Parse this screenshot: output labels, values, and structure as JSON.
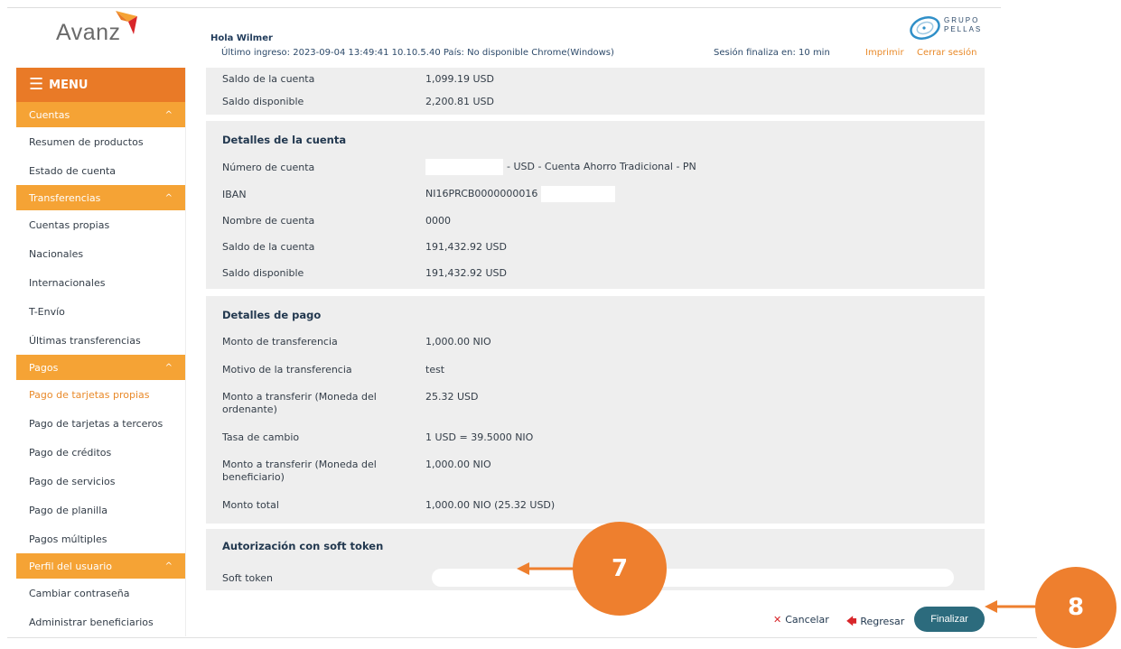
{
  "header": {
    "brand": "Avanz",
    "greeting": "Hola Wilmer",
    "last_login": "Último ingreso: 2023-09-04 13:49:41 10.10.5.40 País: No disponible Chrome(Windows)",
    "session": "Sesión finaliza en: 10 min",
    "print_label": "Imprimir",
    "logout_label": "Cerrar sesión",
    "group_brand": "GRUPO PELLAS"
  },
  "sidebar": {
    "menu_label": "MENU",
    "sections": [
      {
        "label": "Cuentas",
        "items": [
          "Resumen de productos",
          "Estado de cuenta"
        ]
      },
      {
        "label": "Transferencias",
        "items": [
          "Cuentas propias",
          "Nacionales",
          "Internacionales",
          "T-Envío",
          "Últimas transferencias"
        ]
      },
      {
        "label": "Pagos",
        "items": [
          "Pago de tarjetas propias",
          "Pago de tarjetas a terceros",
          "Pago de créditos",
          "Pago de servicios",
          "Pago de planilla",
          "Pagos múltiples"
        ]
      },
      {
        "label": "Perfil del usuario",
        "items": [
          "Cambiar contraseña",
          "Administrar beneficiarios"
        ]
      }
    ],
    "active_item": "Pago de tarjetas propias"
  },
  "origin": {
    "rows": [
      {
        "label": "Saldo de la cuenta",
        "value": "1,099.19 USD"
      },
      {
        "label": "Saldo disponible",
        "value": "2,200.81 USD"
      }
    ]
  },
  "account": {
    "title": "Detalles de la cuenta",
    "rows": [
      {
        "label": "Número de cuenta",
        "value": "- USD - Cuenta Ahorro Tradicional - PN"
      },
      {
        "label": "IBAN",
        "value": "NI16PRCB0000000016"
      },
      {
        "label": "Nombre de cuenta",
        "value": "0000"
      },
      {
        "label": "Saldo de la cuenta",
        "value": "191,432.92 USD"
      },
      {
        "label": "Saldo disponible",
        "value": "191,432.92 USD"
      }
    ]
  },
  "payment": {
    "title": "Detalles de pago",
    "rows": [
      {
        "label": "Monto de transferencia",
        "value": "1,000.00 NIO"
      },
      {
        "label": "Motivo de la transferencia",
        "value": "test"
      },
      {
        "label": "Monto a transferir (Moneda del ordenante)",
        "value": "25.32 USD"
      },
      {
        "label": "Tasa de cambio",
        "value": "1 USD = 39.5000 NIO"
      },
      {
        "label": "Monto a transferir (Moneda del beneficiario)",
        "value": "1,000.00 NIO"
      },
      {
        "label": "Monto total",
        "value": "1,000.00 NIO (25.32 USD)"
      }
    ]
  },
  "token": {
    "title": "Autorización con soft token",
    "label": "Soft token",
    "value": ""
  },
  "actions": {
    "cancel": "Cancelar",
    "back": "Regresar",
    "finish": "Finalizar"
  },
  "annotations": {
    "step7": "7",
    "step8": "8"
  },
  "colors": {
    "accent": "#e97a27",
    "section": "#f5a335",
    "primary_button": "#2c6b7d",
    "panel": "#eeeeee",
    "callout": "#ee7f2e"
  }
}
